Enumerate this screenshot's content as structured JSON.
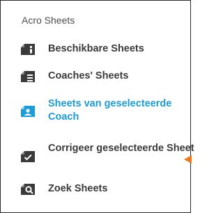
{
  "panel": {
    "title": "Acro Sheets"
  },
  "menu": {
    "items": [
      {
        "label": "Beschikbare Sheets",
        "icon": "sheet-info-icon",
        "active": false
      },
      {
        "label": "Coaches' Sheets",
        "icon": "sheet-list-icon",
        "active": false
      },
      {
        "label": "Sheets van geselecteerde Coach",
        "icon": "sheet-coach-icon",
        "active": true
      },
      {
        "label": "Corrigeer geselecteerde Sheet",
        "icon": "sheet-check-icon",
        "active": false
      },
      {
        "label": "Zoek Sheets",
        "icon": "sheet-search-icon",
        "active": false
      }
    ]
  },
  "colors": {
    "text": "#3a3a3a",
    "title": "#4d4d4d",
    "active": "#1a9cd8",
    "pointer": "#f07a1a",
    "border": "#2a2a2a"
  }
}
